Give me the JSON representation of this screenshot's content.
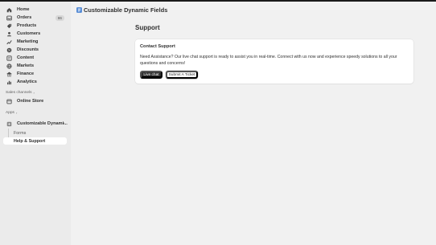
{
  "sidebar": {
    "nav": [
      {
        "label": "Home",
        "icon": "home-icon"
      },
      {
        "label": "Orders",
        "icon": "orders-icon",
        "badge": "86"
      },
      {
        "label": "Products",
        "icon": "products-icon"
      },
      {
        "label": "Customers",
        "icon": "customers-icon"
      },
      {
        "label": "Marketing",
        "icon": "marketing-icon"
      },
      {
        "label": "Discounts",
        "icon": "discounts-icon"
      },
      {
        "label": "Content",
        "icon": "content-icon"
      },
      {
        "label": "Markets",
        "icon": "markets-icon"
      },
      {
        "label": "Finance",
        "icon": "finance-icon"
      },
      {
        "label": "Analytics",
        "icon": "analytics-icon"
      }
    ],
    "sales_channels_label": "Sales channels",
    "online_store_label": "Online Store",
    "apps_label": "Apps",
    "app_name": "Customizable Dynami...",
    "app_sub": [
      {
        "label": "Forms"
      },
      {
        "label": "Help & Support"
      }
    ]
  },
  "header": {
    "app_title": "Customizable Dynamic Fields"
  },
  "page": {
    "title": "Support",
    "card_title": "Contact Support",
    "card_text": "Need Assistance? Our live chat support is ready to assist you in real-time. Connect with us now and experience speedy solutions to all your questions and concerns!",
    "primary_button": "Live chat",
    "secondary_button": "Submit A Ticket"
  },
  "colors": {
    "accent_dark": "#303030",
    "app_logo": "#5b8fd6"
  }
}
